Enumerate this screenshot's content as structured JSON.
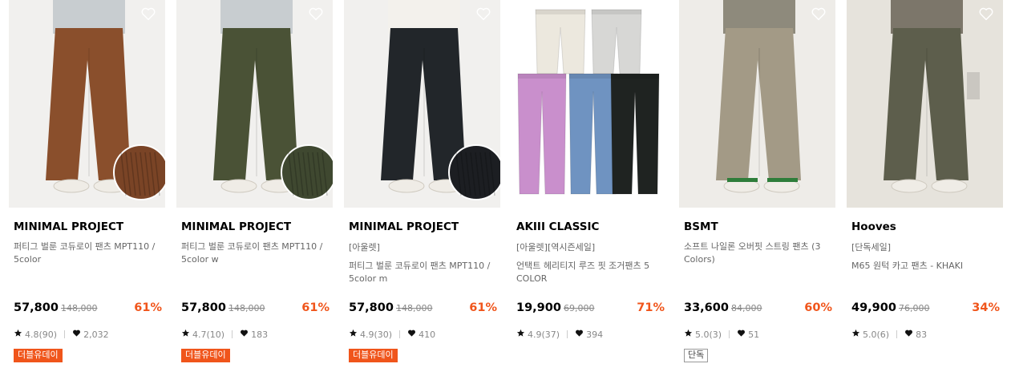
{
  "products": [
    {
      "brand": "MINIMAL PROJECT",
      "tag": "",
      "name": "퍼티그 벌룬 코듀로이 팬츠 MPT110 / 5color",
      "price": "57,800",
      "original_price": "148,000",
      "discount": "61%",
      "rating": "4.8(90)",
      "likes": "2,032",
      "badge": "더블유데이",
      "badge_style": "orange",
      "pants_color": "#8a4f2c",
      "bg_color": "#f1f0ee",
      "swatch_color": "#7a4426"
    },
    {
      "brand": "MINIMAL PROJECT",
      "tag": "",
      "name": "퍼티그 벌룬 코듀로이 팬츠 MPT110 / 5color w",
      "price": "57,800",
      "original_price": "148,000",
      "discount": "61%",
      "rating": "4.7(10)",
      "likes": "183",
      "badge": "더블유데이",
      "badge_style": "orange",
      "pants_color": "#4a5236",
      "bg_color": "#f1f0ee",
      "swatch_color": "#3f4830"
    },
    {
      "brand": "MINIMAL PROJECT",
      "tag": "[아울렛]",
      "name": "퍼티그 벌룬 코듀로이 팬츠 MPT110 / 5color m",
      "price": "57,800",
      "original_price": "148,000",
      "discount": "61%",
      "rating": "4.9(30)",
      "likes": "410",
      "badge": "더블유데이",
      "badge_style": "orange",
      "pants_color": "#22262a",
      "bg_color": "#f1f0ee",
      "swatch_color": "#1c1e22"
    },
    {
      "brand": "AKIII CLASSIC",
      "tag": "[아울렛][역시즌세일]",
      "name": "언택트 헤리티지 루즈 핏 조거팬츠 5 COLOR",
      "price": "19,900",
      "original_price": "69,000",
      "discount": "71%",
      "rating": "4.9(37)",
      "likes": "394",
      "badge": "",
      "badge_style": "none",
      "pants_color": "#6b8fc0",
      "bg_color": "#ffffff",
      "swatch_color": ""
    },
    {
      "brand": "BSMT",
      "tag": "",
      "name": "소프트 나일론 오버핏 스트링 팬츠 (3 Colors)",
      "price": "33,600",
      "original_price": "84,000",
      "discount": "60%",
      "rating": "5.0(3)",
      "likes": "51",
      "badge": "단독",
      "badge_style": "outline",
      "pants_color": "#a39a86",
      "bg_color": "#eeece8",
      "swatch_color": ""
    },
    {
      "brand": "Hooves",
      "tag": "[단독세일]",
      "name": "M65 원턱 카고 팬츠 - KHAKI",
      "price": "49,900",
      "original_price": "76,000",
      "discount": "34%",
      "rating": "5.0(6)",
      "likes": "83",
      "badge": "",
      "badge_style": "none",
      "pants_color": "#5d5e4c",
      "bg_color": "#e6e3dc",
      "swatch_color": ""
    }
  ],
  "icons": {
    "wishlist": "heart-outline-icon",
    "rating": "star-icon",
    "likes": "heart-filled-icon"
  },
  "colors": {
    "discount": "#f0551b",
    "badge": "#f0551b"
  }
}
